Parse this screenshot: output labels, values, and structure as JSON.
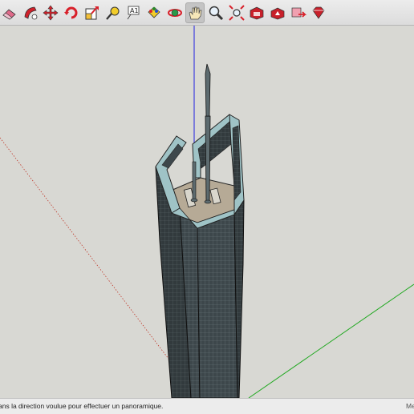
{
  "toolbar": {
    "tools": [
      {
        "icon": "eraser-icon"
      },
      {
        "icon": "follow-me-icon"
      },
      {
        "icon": "move-icon"
      },
      {
        "icon": "rotate-icon"
      },
      {
        "icon": "scale-icon"
      },
      {
        "icon": "tape-measure-icon"
      },
      {
        "icon": "text-icon",
        "label": "A1"
      },
      {
        "icon": "paint-bucket-icon"
      },
      {
        "icon": "orbit-icon"
      },
      {
        "icon": "pan-hand-icon",
        "active": true
      },
      {
        "icon": "zoom-icon"
      },
      {
        "icon": "zoom-extents-icon"
      },
      {
        "icon": "warehouse-get-models-icon"
      },
      {
        "icon": "warehouse-share-model-icon"
      },
      {
        "icon": "share-component-icon"
      },
      {
        "icon": "extension-warehouse-icon"
      }
    ]
  },
  "colors": {
    "background": "#d8d8d3",
    "blue_axis": "#2020e0",
    "green_axis": "#1fa81f",
    "red_axis": "#c0392b",
    "facade": "#3d474b",
    "glass": "#9fc3c6",
    "roof": "#b6aa96"
  },
  "status_bar": {
    "text": "ans la direction voulue pour effectuer un panoramique.",
    "measure_label": "Me"
  }
}
